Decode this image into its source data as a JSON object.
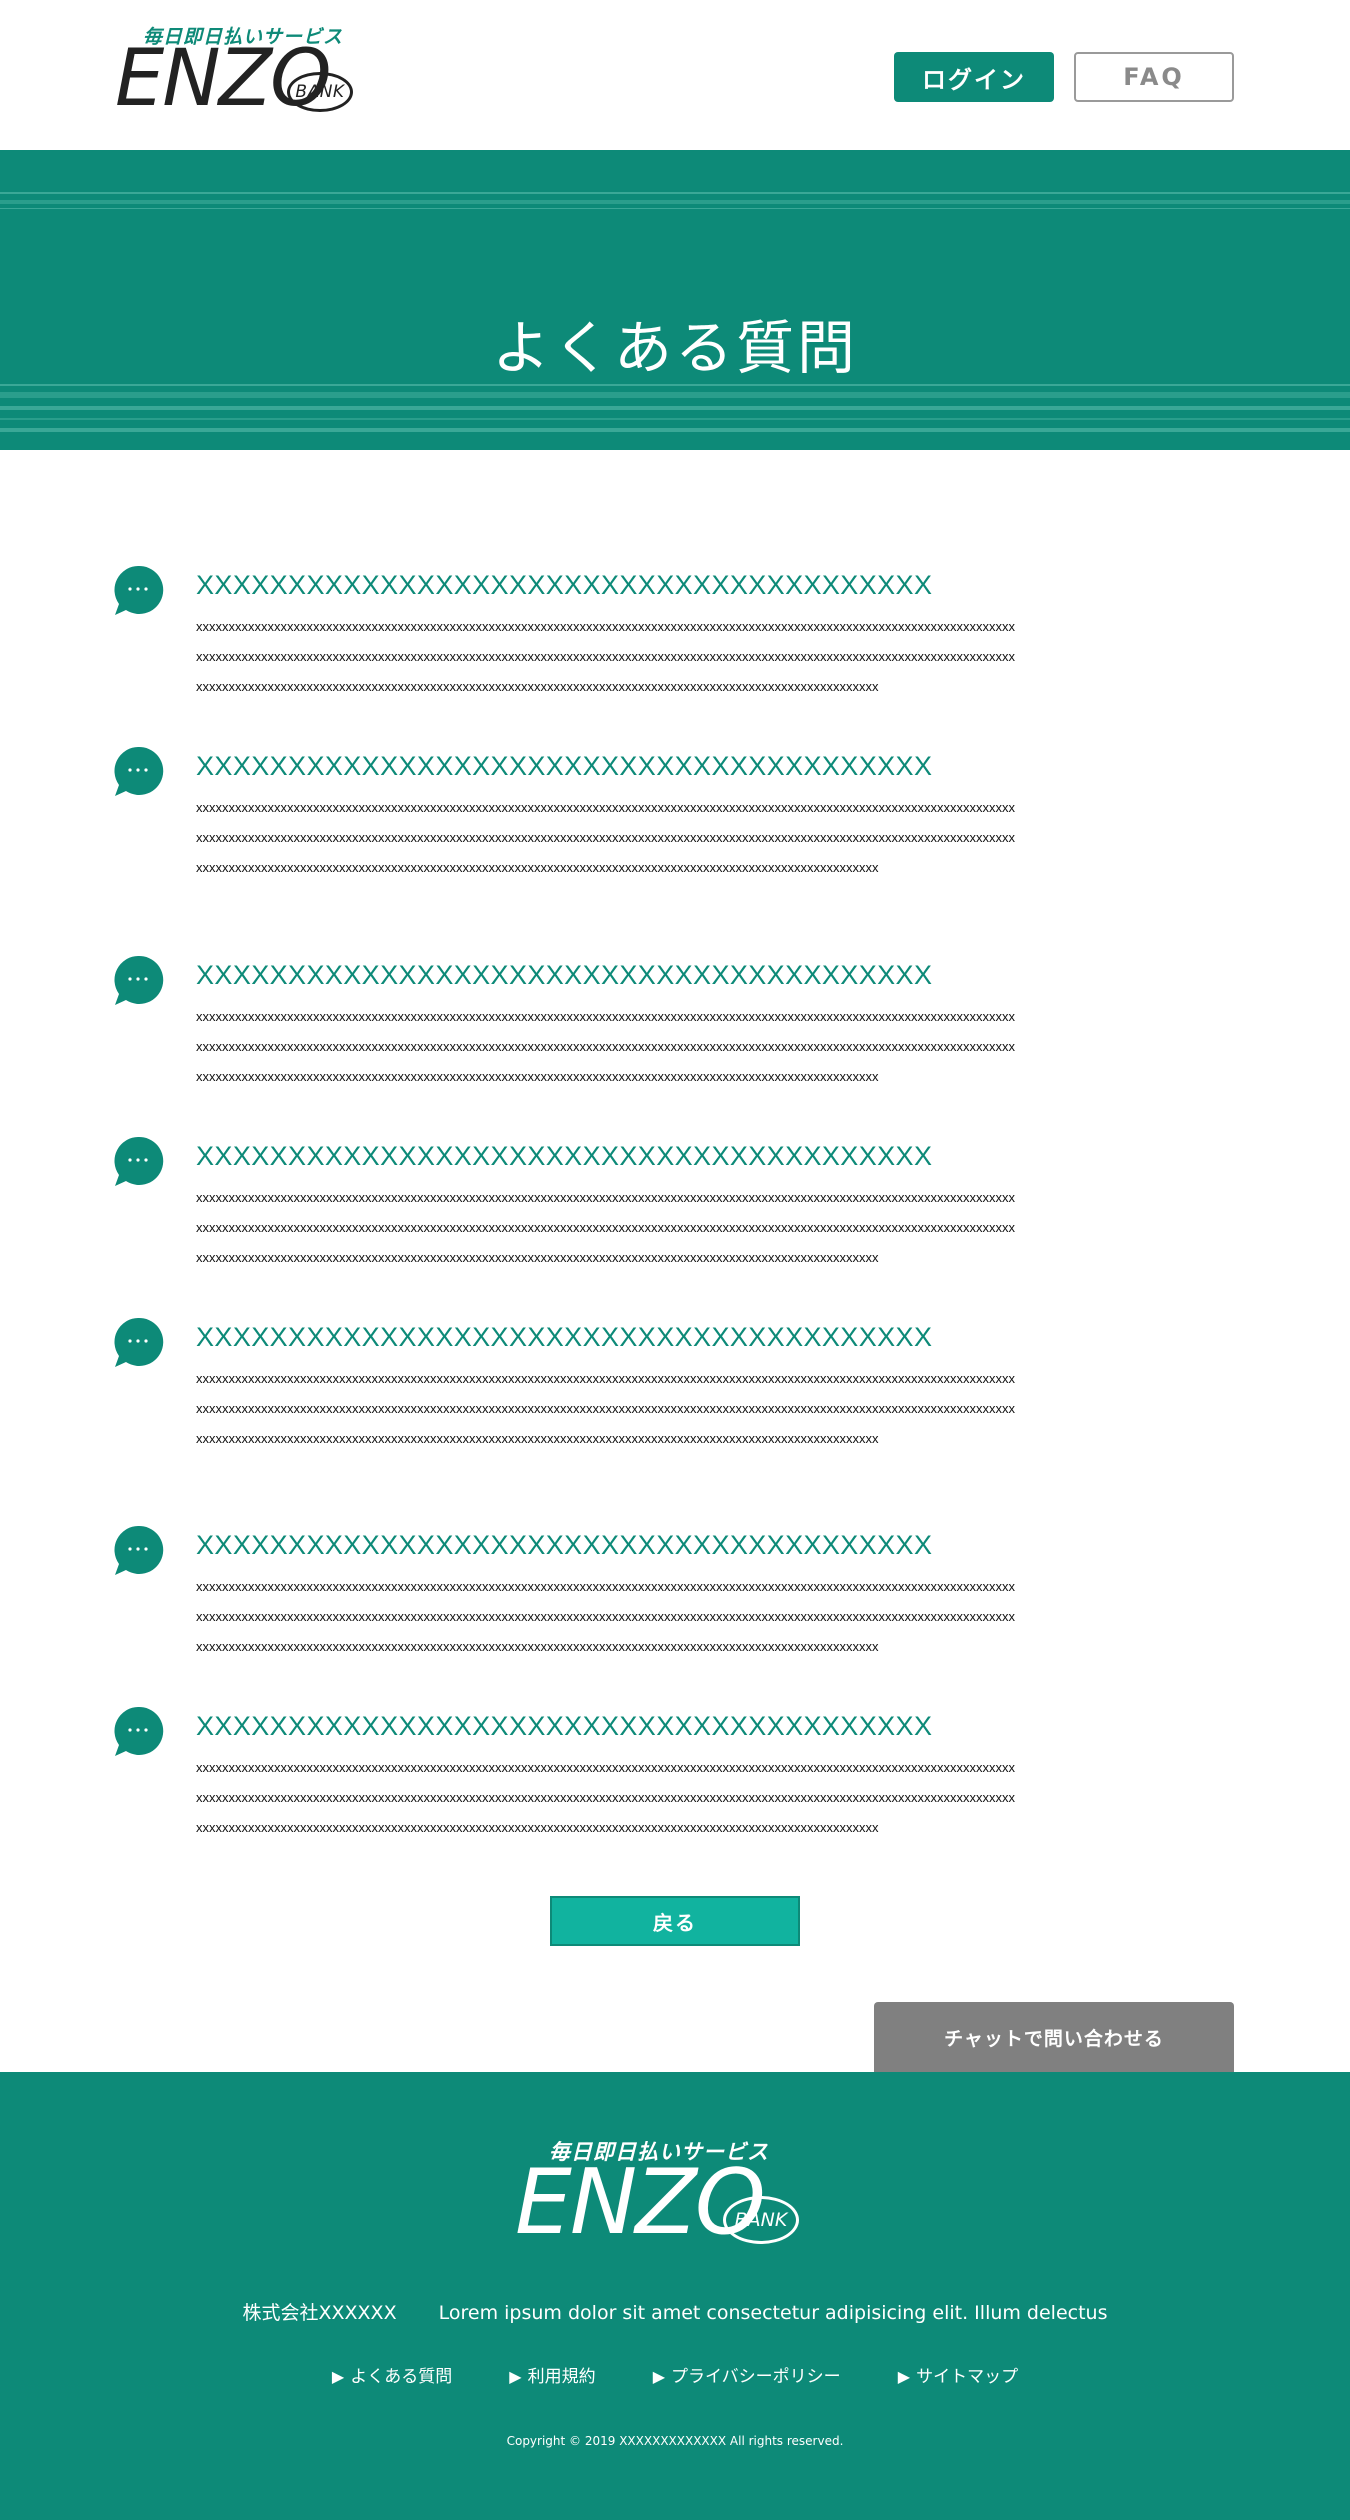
{
  "header": {
    "logo": {
      "tagline": "毎日即日払いサービス",
      "brand": "ENZO",
      "bank": "BANK"
    },
    "login_label": "ログイン",
    "faq_label": "FAQ"
  },
  "hero": {
    "title": "よくある質問"
  },
  "faq": {
    "items": [
      {
        "question": "XXXXXXXXXXXXXXXXXXXXXXXXXXXXXXXXXXXXXXXX",
        "answer": [
          "xxxxxxxxxxxxxxxxxxxxxxxxxxxxxxxxxxxxxxxxxxxxxxxxxxxxxxxxxxxxxxxxxxxxxxxxxxxxxxxxxxxxxxxxxxxxxxxxxxxxxxxxxxxxxxxxxxxxxxxxxxxxxx",
          "xxxxxxxxxxxxxxxxxxxxxxxxxxxxxxxxxxxxxxxxxxxxxxxxxxxxxxxxxxxxxxxxxxxxxxxxxxxxxxxxxxxxxxxxxxxxxxxxxxxxxxxxxxxxxxxxxxxxxxxxxxxxxx",
          "xxxxxxxxxxxxxxxxxxxxxxxxxxxxxxxxxxxxxxxxxxxxxxxxxxxxxxxxxxxxxxxxxxxxxxxxxxxxxxxxxxxxxxxxxxxxxxxxxxxxxxxxx"
        ]
      },
      {
        "question": "XXXXXXXXXXXXXXXXXXXXXXXXXXXXXXXXXXXXXXXX",
        "answer": [
          "xxxxxxxxxxxxxxxxxxxxxxxxxxxxxxxxxxxxxxxxxxxxxxxxxxxxxxxxxxxxxxxxxxxxxxxxxxxxxxxxxxxxxxxxxxxxxxxxxxxxxxxxxxxxxxxxxxxxxxxxxxxxxx",
          "xxxxxxxxxxxxxxxxxxxxxxxxxxxxxxxxxxxxxxxxxxxxxxxxxxxxxxxxxxxxxxxxxxxxxxxxxxxxxxxxxxxxxxxxxxxxxxxxxxxxxxxxxxxxxxxxxxxxxxxxxxxxxx",
          "xxxxxxxxxxxxxxxxxxxxxxxxxxxxxxxxxxxxxxxxxxxxxxxxxxxxxxxxxxxxxxxxxxxxxxxxxxxxxxxxxxxxxxxxxxxxxxxxxxxxxxxxx"
        ]
      },
      {
        "question": "XXXXXXXXXXXXXXXXXXXXXXXXXXXXXXXXXXXXXXXX",
        "answer": [
          "xxxxxxxxxxxxxxxxxxxxxxxxxxxxxxxxxxxxxxxxxxxxxxxxxxxxxxxxxxxxxxxxxxxxxxxxxxxxxxxxxxxxxxxxxxxxxxxxxxxxxxxxxxxxxxxxxxxxxxxxxxxxxx",
          "xxxxxxxxxxxxxxxxxxxxxxxxxxxxxxxxxxxxxxxxxxxxxxxxxxxxxxxxxxxxxxxxxxxxxxxxxxxxxxxxxxxxxxxxxxxxxxxxxxxxxxxxxxxxxxxxxxxxxxxxxxxxxx",
          "xxxxxxxxxxxxxxxxxxxxxxxxxxxxxxxxxxxxxxxxxxxxxxxxxxxxxxxxxxxxxxxxxxxxxxxxxxxxxxxxxxxxxxxxxxxxxxxxxxxxxxxxx"
        ]
      },
      {
        "question": "XXXXXXXXXXXXXXXXXXXXXXXXXXXXXXXXXXXXXXXX",
        "answer": [
          "xxxxxxxxxxxxxxxxxxxxxxxxxxxxxxxxxxxxxxxxxxxxxxxxxxxxxxxxxxxxxxxxxxxxxxxxxxxxxxxxxxxxxxxxxxxxxxxxxxxxxxxxxxxxxxxxxxxxxxxxxxxxxx",
          "xxxxxxxxxxxxxxxxxxxxxxxxxxxxxxxxxxxxxxxxxxxxxxxxxxxxxxxxxxxxxxxxxxxxxxxxxxxxxxxxxxxxxxxxxxxxxxxxxxxxxxxxxxxxxxxxxxxxxxxxxxxxxx",
          "xxxxxxxxxxxxxxxxxxxxxxxxxxxxxxxxxxxxxxxxxxxxxxxxxxxxxxxxxxxxxxxxxxxxxxxxxxxxxxxxxxxxxxxxxxxxxxxxxxxxxxxxx"
        ]
      },
      {
        "question": "XXXXXXXXXXXXXXXXXXXXXXXXXXXXXXXXXXXXXXXX",
        "answer": [
          "xxxxxxxxxxxxxxxxxxxxxxxxxxxxxxxxxxxxxxxxxxxxxxxxxxxxxxxxxxxxxxxxxxxxxxxxxxxxxxxxxxxxxxxxxxxxxxxxxxxxxxxxxxxxxxxxxxxxxxxxxxxxxx",
          "xxxxxxxxxxxxxxxxxxxxxxxxxxxxxxxxxxxxxxxxxxxxxxxxxxxxxxxxxxxxxxxxxxxxxxxxxxxxxxxxxxxxxxxxxxxxxxxxxxxxxxxxxxxxxxxxxxxxxxxxxxxxxx",
          "xxxxxxxxxxxxxxxxxxxxxxxxxxxxxxxxxxxxxxxxxxxxxxxxxxxxxxxxxxxxxxxxxxxxxxxxxxxxxxxxxxxxxxxxxxxxxxxxxxxxxxxxx"
        ]
      },
      {
        "question": "XXXXXXXXXXXXXXXXXXXXXXXXXXXXXXXXXXXXXXXX",
        "answer": [
          "xxxxxxxxxxxxxxxxxxxxxxxxxxxxxxxxxxxxxxxxxxxxxxxxxxxxxxxxxxxxxxxxxxxxxxxxxxxxxxxxxxxxxxxxxxxxxxxxxxxxxxxxxxxxxxxxxxxxxxxxxxxxxx",
          "xxxxxxxxxxxxxxxxxxxxxxxxxxxxxxxxxxxxxxxxxxxxxxxxxxxxxxxxxxxxxxxxxxxxxxxxxxxxxxxxxxxxxxxxxxxxxxxxxxxxxxxxxxxxxxxxxxxxxxxxxxxxxx",
          "xxxxxxxxxxxxxxxxxxxxxxxxxxxxxxxxxxxxxxxxxxxxxxxxxxxxxxxxxxxxxxxxxxxxxxxxxxxxxxxxxxxxxxxxxxxxxxxxxxxxxxxxx"
        ]
      },
      {
        "question": "XXXXXXXXXXXXXXXXXXXXXXXXXXXXXXXXXXXXXXXX",
        "answer": [
          "xxxxxxxxxxxxxxxxxxxxxxxxxxxxxxxxxxxxxxxxxxxxxxxxxxxxxxxxxxxxxxxxxxxxxxxxxxxxxxxxxxxxxxxxxxxxxxxxxxxxxxxxxxxxxxxxxxxxxxxxxxxxxx",
          "xxxxxxxxxxxxxxxxxxxxxxxxxxxxxxxxxxxxxxxxxxxxxxxxxxxxxxxxxxxxxxxxxxxxxxxxxxxxxxxxxxxxxxxxxxxxxxxxxxxxxxxxxxxxxxxxxxxxxxxxxxxxxx",
          "xxxxxxxxxxxxxxxxxxxxxxxxxxxxxxxxxxxxxxxxxxxxxxxxxxxxxxxxxxxxxxxxxxxxxxxxxxxxxxxxxxxxxxxxxxxxxxxxxxxxxxxxx"
        ]
      }
    ]
  },
  "actions": {
    "back_label": "戻る",
    "chat_label": "チャットで問い合わせる"
  },
  "footer": {
    "logo": {
      "tagline": "毎日即日払いサービス",
      "brand": "ENZO",
      "bank": "BANK"
    },
    "company_name": "株式会社XXXXXX",
    "company_desc": "Lorem ipsum dolor sit amet consectetur adipisicing elit. Illum delectus",
    "nav": [
      "よくある質問",
      "利用規約",
      "プライバシーポリシー",
      "サイトマップ"
    ],
    "copyright": "Copyright © 2019 XXXXXXXXXXXXX All rights reserved."
  },
  "colors": {
    "brand_green": "#0d8a78",
    "button_teal": "#11b39f",
    "chat_gray": "#808080"
  },
  "icons": {
    "faq_item": "speech-bubble-icon",
    "nav_bullet": "triangle-right-icon"
  }
}
